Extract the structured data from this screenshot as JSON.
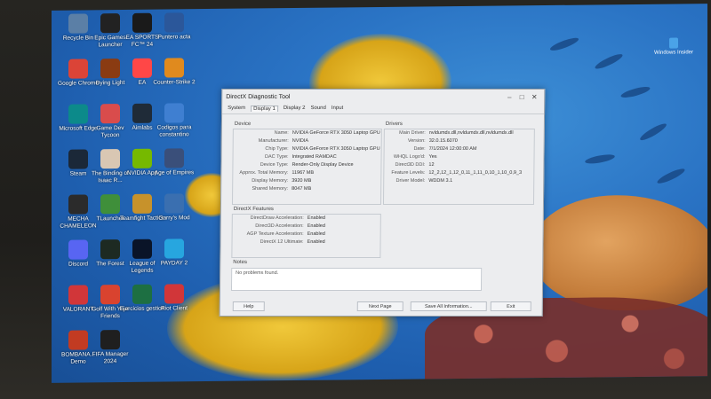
{
  "desktop": {
    "icons": [
      {
        "label": "Recycle Bin",
        "name": "recycle-bin-icon",
        "color": "#5b7fa6"
      },
      {
        "label": "Epic Games Launcher",
        "name": "epic-games-icon",
        "color": "#222222"
      },
      {
        "label": "EA SPORTS FC™ 24",
        "name": "ea-sports-fc-icon",
        "color": "#1a1a1a"
      },
      {
        "label": "Puntero acta",
        "name": "word-document-icon",
        "color": "#2b579a"
      },
      {
        "label": "Google Chrome",
        "name": "chrome-icon",
        "color": "#db4437"
      },
      {
        "label": "Dying Light",
        "name": "dying-light-icon",
        "color": "#8a3b12"
      },
      {
        "label": "EA",
        "name": "ea-icon",
        "color": "#ff4747"
      },
      {
        "label": "Counter-Strike 2",
        "name": "counter-strike-icon",
        "color": "#e08a1e"
      },
      {
        "label": "Microsoft Edge",
        "name": "edge-icon",
        "color": "#0c8a8a"
      },
      {
        "label": "Game Dev Tycoon",
        "name": "game-dev-tycoon-icon",
        "color": "#d94c4c"
      },
      {
        "label": "Aimlabs",
        "name": "aimlabs-icon",
        "color": "#1f2b38"
      },
      {
        "label": "Codigos para constantino",
        "name": "text-document-icon",
        "color": "#3f7fd1"
      },
      {
        "label": "Steam",
        "name": "steam-icon",
        "color": "#1b2838"
      },
      {
        "label": "The Binding of Isaac R...",
        "name": "isaac-icon",
        "color": "#d9c7b3"
      },
      {
        "label": "NVIDIA App",
        "name": "nvidia-icon",
        "color": "#76b900"
      },
      {
        "label": "Age of Empires",
        "name": "age-of-empires-icon",
        "color": "#3a4f7a"
      },
      {
        "label": "MECHA CHAMELEON",
        "name": "mecha-chameleon-icon",
        "color": "#2b2b2b"
      },
      {
        "label": "TLauncher",
        "name": "tlauncher-icon",
        "color": "#3f8f3a"
      },
      {
        "label": "Teamfight Tactics",
        "name": "tft-icon",
        "color": "#c7922b"
      },
      {
        "label": "Garry's Mod",
        "name": "garrys-mod-icon",
        "color": "#3a6fb0"
      },
      {
        "label": "Discord",
        "name": "discord-icon",
        "color": "#5865f2"
      },
      {
        "label": "The Forest",
        "name": "the-forest-icon",
        "color": "#1d2a22"
      },
      {
        "label": "League of Legends",
        "name": "league-icon",
        "color": "#0a1428"
      },
      {
        "label": "PAYDAY 2",
        "name": "payday-icon",
        "color": "#27a6df"
      },
      {
        "label": "VALORANT",
        "name": "valorant-icon",
        "color": "#d13639"
      },
      {
        "label": "Golf With Your Friends",
        "name": "golf-icon",
        "color": "#d9432f"
      },
      {
        "label": "Ejercicios gestion",
        "name": "excel-icon",
        "color": "#1d6f42"
      },
      {
        "label": "Riot Client",
        "name": "riot-client-icon",
        "color": "#d13639"
      },
      {
        "label": "BOMBANA... Demo",
        "name": "bombana-icon",
        "color": "#c23b22"
      },
      {
        "label": "FIFA Manager 2024",
        "name": "fifa-manager-icon",
        "color": "#1f1f1f"
      }
    ],
    "watermark": "Windows Insider"
  },
  "dxdiag": {
    "title": "DirectX Diagnostic Tool",
    "tabs": [
      "System",
      "Display 1",
      "Display 2",
      "Sound",
      "Input"
    ],
    "active_tab": "Display 1",
    "device_label": "Device",
    "drivers_label": "Drivers",
    "device_rows": [
      {
        "k": "Name:",
        "v": "NVIDIA GeForce RTX 3050 Laptop GPU"
      },
      {
        "k": "Manufacturer:",
        "v": "NVIDIA"
      },
      {
        "k": "Chip Type:",
        "v": "NVIDIA GeForce RTX 3050 Laptop GPU"
      },
      {
        "k": "DAC Type:",
        "v": "Integrated RAMDAC"
      },
      {
        "k": "Device Type:",
        "v": "Render-Only Display Device"
      },
      {
        "k": "Approx. Total Memory:",
        "v": "11967 MB"
      },
      {
        "k": "Display Memory:",
        "v": "3920 MB"
      },
      {
        "k": "Shared Memory:",
        "v": "8047 MB"
      }
    ],
    "driver_rows": [
      {
        "k": "Main Driver:",
        "v": "nvldumdx.dll,nvldumdx.dll,nvldumdx.dll"
      },
      {
        "k": "Version:",
        "v": "32.0.15.6070"
      },
      {
        "k": "Date:",
        "v": "7/1/2024 12:00:00 AM"
      },
      {
        "k": "WHQL Logo'd:",
        "v": "Yes"
      },
      {
        "k": "Direct3D DDI:",
        "v": "12"
      },
      {
        "k": "Feature Levels:",
        "v": "12_2,12_1,12_0,11_1,11_0,10_1,10_0,9_3"
      },
      {
        "k": "Driver Model:",
        "v": "WDDM 3.1"
      }
    ],
    "features_label": "DirectX Features",
    "feature_rows": [
      {
        "k": "DirectDraw Acceleration:",
        "v": "Enabled"
      },
      {
        "k": "Direct3D Acceleration:",
        "v": "Enabled"
      },
      {
        "k": "AGP Texture Acceleration:",
        "v": "Enabled"
      },
      {
        "k": "DirectX 12 Ultimate:",
        "v": "Enabled"
      }
    ],
    "notes_label": "Notes",
    "notes_text": "No problems found.",
    "buttons": {
      "help": "Help",
      "next_page": "Next Page",
      "save_all": "Save All Information...",
      "exit": "Exit"
    }
  }
}
